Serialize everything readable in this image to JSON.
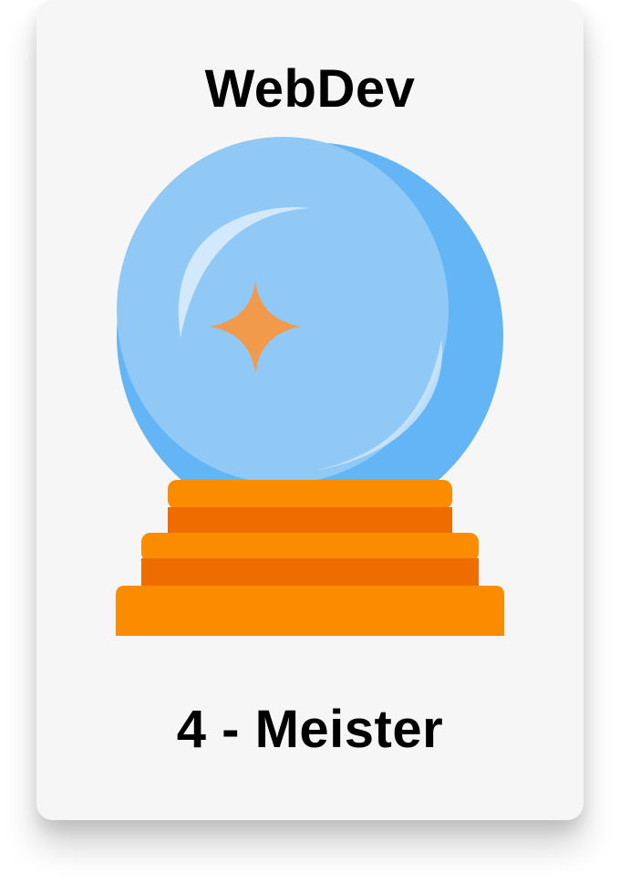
{
  "card": {
    "title": "WebDev",
    "level_label": "4 - Meister"
  },
  "badge": {
    "icon": "crystal-ball-icon",
    "colors": {
      "card_background": "#f6f6f6",
      "ball_main": "#90c8f6",
      "ball_shade": "#64b5f6",
      "ball_highlight": "#d6ebfb",
      "sparkle": "#f19a4c",
      "base_light": "#fb8c00",
      "base_dark": "#ef6c00"
    }
  }
}
